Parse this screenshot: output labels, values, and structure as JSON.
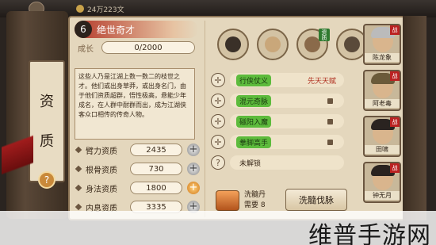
{
  "topbar": {
    "currency": "24万223文"
  },
  "side_tabs": {
    "tab1": "资",
    "tab2": "质",
    "help": "?"
  },
  "header": {
    "number": "6",
    "title": "绝世奇才"
  },
  "growth": {
    "label": "成长",
    "value": "0/2000"
  },
  "description": "这些人乃是江湖上数一数二的枝世之才。他们或出身草莽，或出身名门，由于他们资质超群，悟性极高，悬能少年成名，在人群中耐群而出，成为江湖侠客众口相传的传奇人物。",
  "attributes": [
    {
      "label": "臂力资质",
      "value": "2435",
      "active": false
    },
    {
      "label": "根骨资质",
      "value": "730",
      "active": false
    },
    {
      "label": "身法资质",
      "value": "1800",
      "active": true
    },
    {
      "label": "内息资质",
      "value": "3335",
      "active": false
    }
  ],
  "skills": [
    {
      "icon": "warrior-icon",
      "tag": ""
    },
    {
      "icon": "bun-icon",
      "tag": ""
    },
    {
      "icon": "scroll-icon",
      "tag": "资质"
    },
    {
      "icon": "monkey-icon",
      "tag": ""
    }
  ],
  "techniques": [
    {
      "name": "行侠仗义",
      "style": "plain",
      "requirement": "先天天赋",
      "locked": false
    },
    {
      "name": "混元奇脉",
      "style": "green",
      "requirement": "",
      "locked": true
    },
    {
      "name": "磁阳入魔",
      "style": "green",
      "requirement": "",
      "locked": true
    },
    {
      "name": "拳脚高手",
      "style": "green",
      "requirement": "",
      "locked": true
    },
    {
      "name": "未解锁",
      "style": "plain",
      "requirement": "",
      "locked": false
    }
  ],
  "item": {
    "name": "洗髓丹",
    "need_label": "需要",
    "need_value": "8"
  },
  "purify_button": "洗髓伐脉",
  "roster": [
    {
      "name": "陈龙象",
      "badge": "战"
    },
    {
      "name": "阿老毒",
      "badge": "战"
    },
    {
      "name": "田啸",
      "badge": "战"
    },
    {
      "name": "钟无月",
      "badge": "战"
    }
  ],
  "watermark": "维普手游网",
  "colors": {
    "accent_red": "#b43a2b",
    "paper": "#e4d7bd",
    "green_tag": "#5dbb3c",
    "orange_plus": "#d27a1c"
  }
}
